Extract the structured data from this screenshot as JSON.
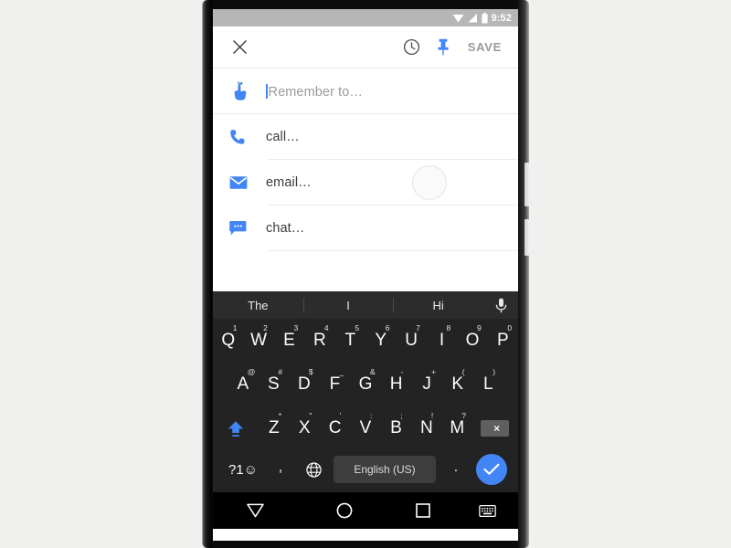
{
  "device": {
    "status_bar": {
      "time": "9:52",
      "icons": [
        "wifi-icon",
        "signal-icon",
        "battery-icon"
      ]
    },
    "nav_bar": {
      "buttons": [
        {
          "name": "back-button",
          "icon": "triangle-down-icon"
        },
        {
          "name": "home-button",
          "icon": "circle-icon"
        },
        {
          "name": "recents-button",
          "icon": "square-icon"
        },
        {
          "name": "hide-keyboard-button",
          "icon": "keyboard-icon"
        }
      ]
    }
  },
  "toolbar": {
    "close_icon": "close-icon",
    "time_icon": "clock-icon",
    "pin_icon": "pin-icon",
    "save_label": "SAVE",
    "pin_color": "#4285f4",
    "save_color": "#9a9a9a"
  },
  "reminder": {
    "input": {
      "value": "",
      "placeholder": "Remember to…",
      "icon": "reminder-hand-icon"
    },
    "options": [
      {
        "label": "call…",
        "icon": "phone-icon"
      },
      {
        "label": "email…",
        "icon": "mail-icon"
      },
      {
        "label": "chat…",
        "icon": "chat-icon"
      }
    ],
    "icon_color": "#4285f4"
  },
  "keyboard": {
    "suggestions": [
      "The",
      "I",
      "Hi"
    ],
    "mic_icon": "microphone-icon",
    "row1": [
      {
        "key": "Q",
        "sup": "1"
      },
      {
        "key": "W",
        "sup": "2"
      },
      {
        "key": "E",
        "sup": "3"
      },
      {
        "key": "R",
        "sup": "4"
      },
      {
        "key": "T",
        "sup": "5"
      },
      {
        "key": "Y",
        "sup": "6"
      },
      {
        "key": "U",
        "sup": "7"
      },
      {
        "key": "I",
        "sup": "8"
      },
      {
        "key": "O",
        "sup": "9"
      },
      {
        "key": "P",
        "sup": "0"
      }
    ],
    "row2": [
      {
        "key": "A",
        "sup": "@"
      },
      {
        "key": "S",
        "sup": "#"
      },
      {
        "key": "D",
        "sup": "$"
      },
      {
        "key": "F",
        "sup": "_"
      },
      {
        "key": "G",
        "sup": "&"
      },
      {
        "key": "H",
        "sup": "-"
      },
      {
        "key": "J",
        "sup": "+"
      },
      {
        "key": "K",
        "sup": "("
      },
      {
        "key": "L",
        "sup": ")"
      }
    ],
    "row3": [
      {
        "key": "Z",
        "sup": "*"
      },
      {
        "key": "X",
        "sup": "\""
      },
      {
        "key": "C",
        "sup": "'"
      },
      {
        "key": "V",
        "sup": ":"
      },
      {
        "key": "B",
        "sup": ";"
      },
      {
        "key": "N",
        "sup": "!"
      },
      {
        "key": "M",
        "sup": "?"
      }
    ],
    "shift_icon": "shift-up-icon",
    "backspace_icon": "backspace-icon",
    "symbols_label": "?1☺",
    "comma_label": ",",
    "globe_icon": "globe-icon",
    "space_label": "English (US)",
    "period_label": ".",
    "enter_icon": "check-icon",
    "accent_color": "#4285f4",
    "bg_color": "#232323",
    "strip_color": "#2c2c2c"
  }
}
